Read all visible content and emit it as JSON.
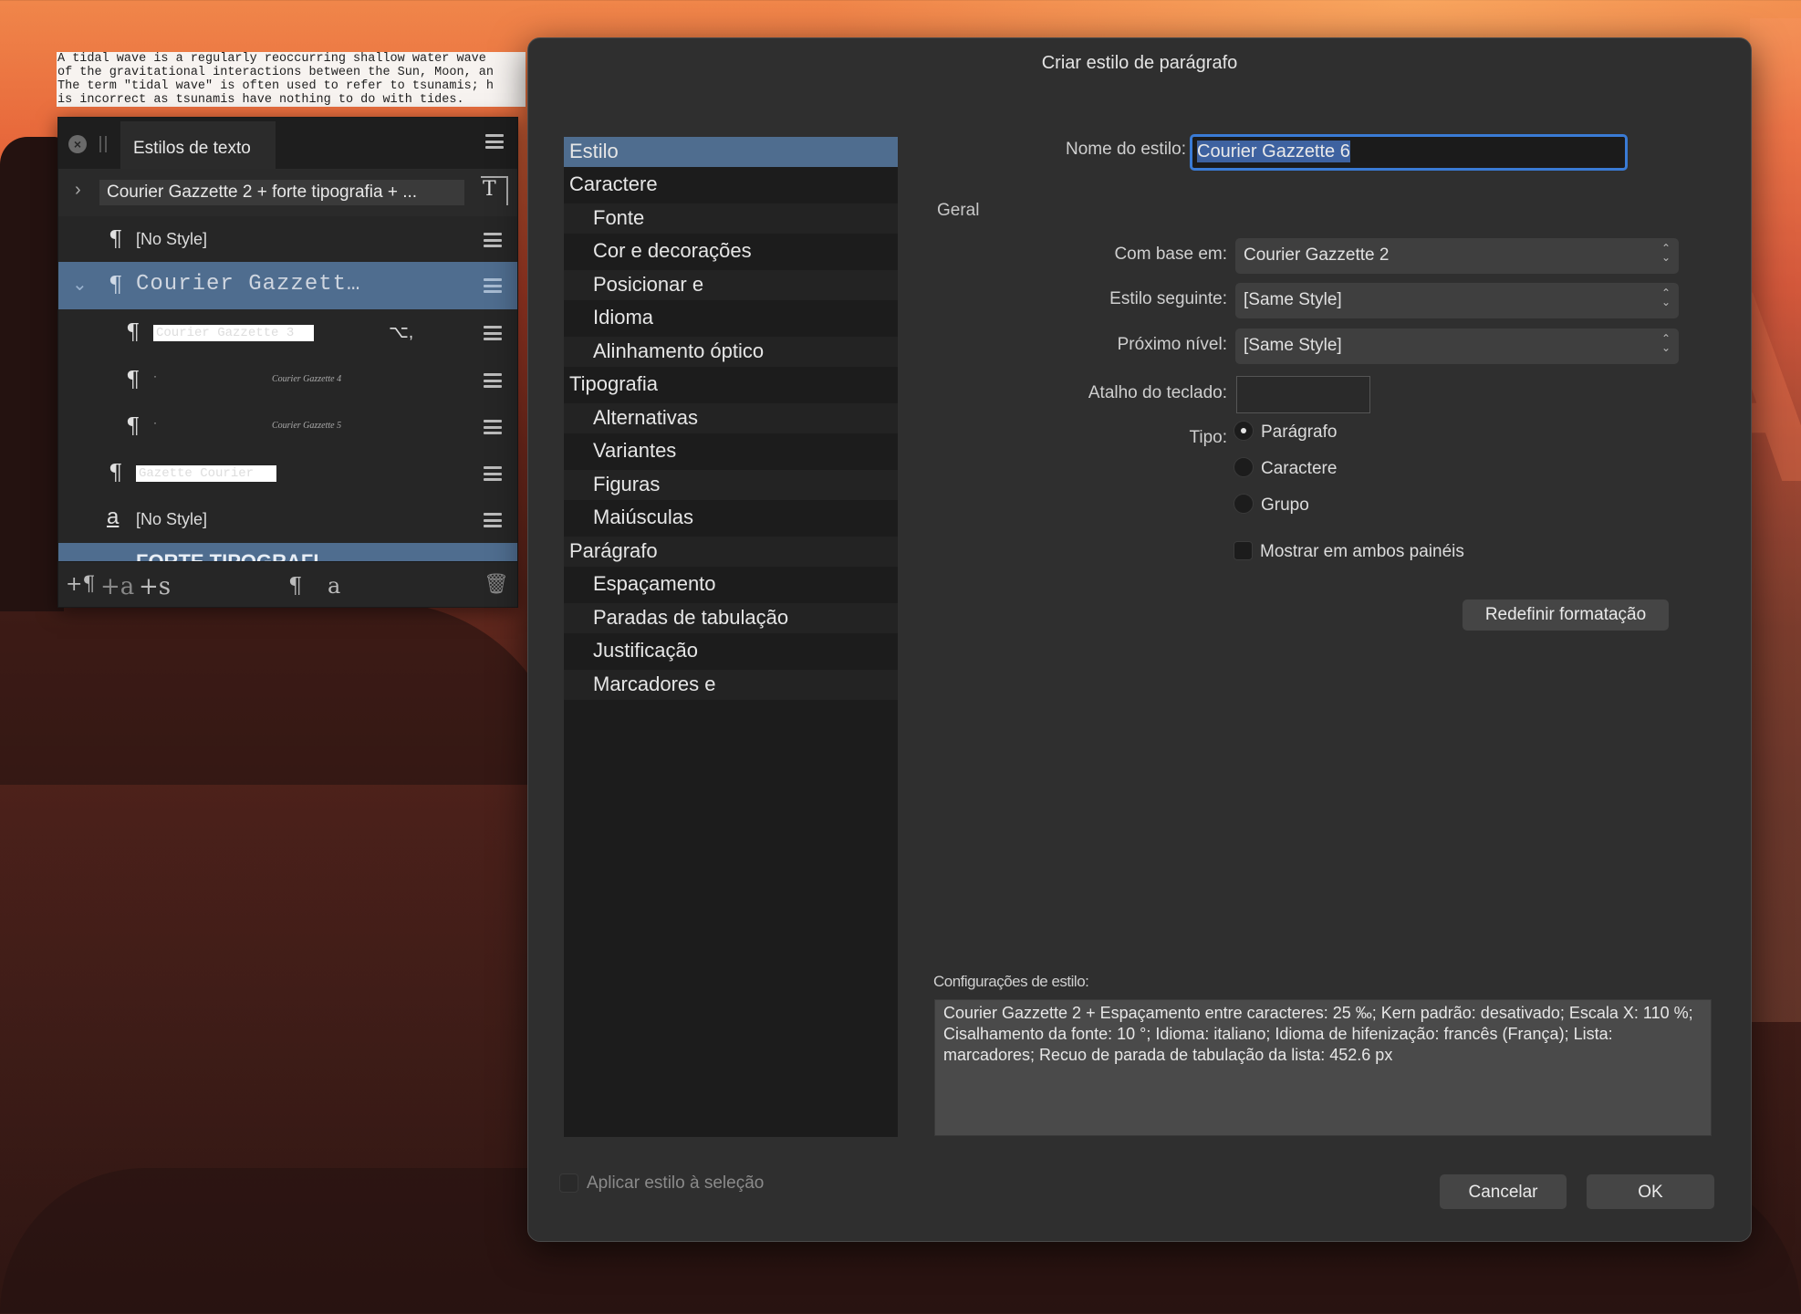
{
  "document": {
    "text": "A tidal wave is a regularly reoccurring shallow water wave\nof the gravitational interactions between the Sun, Moon, an\nThe term \"tidal wave\" is often used to refer to tsunamis; h\nis incorrect as tsunamis have nothing to do with tides."
  },
  "panel": {
    "title": "Estilos de texto",
    "rows": [
      {
        "label": "Courier Gazzette 2 + forte tipografia + ..."
      },
      {
        "label": "[No Style]"
      },
      {
        "label": "Courier Gazzett…"
      },
      {
        "label": "Courier Gazzette 3",
        "shortcut": "⌥,"
      },
      {
        "label": "Courier Gazzette 4"
      },
      {
        "label": "Courier Gazzette 5"
      },
      {
        "label": "Gazette Courier"
      },
      {
        "label": "[No Style]"
      },
      {
        "label": "FORTE TIPOGRAFI"
      }
    ],
    "footer_icons": [
      "+¶",
      "+a",
      "+s"
    ]
  },
  "dialog": {
    "title": "Criar estilo de parágrafo",
    "categories": [
      {
        "label": "Estilo",
        "level": "top"
      },
      {
        "label": "Caractere",
        "level": "top"
      },
      {
        "label": "Fonte",
        "level": "sub"
      },
      {
        "label": "Cor e decorações",
        "level": "sub"
      },
      {
        "label": "Posicionar e",
        "level": "sub"
      },
      {
        "label": "Idioma",
        "level": "sub"
      },
      {
        "label": "Alinhamento óptico",
        "level": "sub"
      },
      {
        "label": "Tipografia",
        "level": "top"
      },
      {
        "label": "Alternativas",
        "level": "sub"
      },
      {
        "label": "Variantes",
        "level": "sub"
      },
      {
        "label": "Figuras",
        "level": "sub"
      },
      {
        "label": "Maiúsculas",
        "level": "sub"
      },
      {
        "label": "Parágrafo",
        "level": "top"
      },
      {
        "label": "Espaçamento",
        "level": "sub"
      },
      {
        "label": "Paradas de tabulação",
        "level": "sub"
      },
      {
        "label": "Justificação",
        "level": "sub"
      },
      {
        "label": "Marcadores e",
        "level": "sub"
      }
    ],
    "style_name_label": "Nome do estilo:",
    "style_name_value": "Courier Gazzette 6",
    "general_label": "Geral",
    "based_on_label": "Com base em:",
    "based_on_value": "Courier Gazzette 2",
    "next_style_label": "Estilo seguinte:",
    "next_style_value": "[Same Style]",
    "next_level_label": "Próximo nível:",
    "next_level_value": "[Same Style]",
    "shortcut_label": "Atalho do teclado:",
    "type_label": "Tipo:",
    "type_options": [
      "Parágrafo",
      "Caractere",
      "Grupo"
    ],
    "type_selected": "Parágrafo",
    "show_both_label": "Mostrar em ambos painéis",
    "reset_button": "Redefinir formatação",
    "settings_label": "Configurações de estilo:",
    "settings_text": "Courier Gazzette 2 + Espaçamento entre caracteres: 25 ‰; Kern padrão: desativado; Escala X: 110 %; Cisalhamento da fonte: 10 °; Idioma: italiano; Idioma de hifenização: francês (França); Lista: marcadores; Recuo de parada de tabulação da lista: 452.6 px",
    "apply_label": "Aplicar estilo à seleção",
    "cancel_button": "Cancelar",
    "ok_button": "OK"
  }
}
